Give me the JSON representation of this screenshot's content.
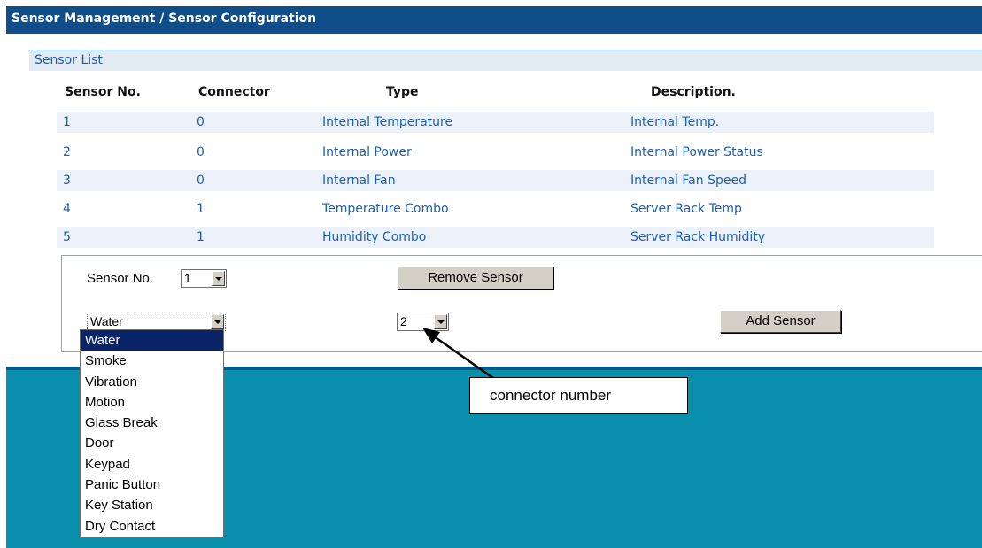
{
  "title": "Sensor Management / Sensor Configuration",
  "section_title": "Sensor List",
  "table": {
    "headers": [
      "Sensor No.",
      "Connector",
      "Type",
      "Description."
    ],
    "rows": [
      [
        "1",
        "0",
        "Internal Temperature",
        "Internal Temp."
      ],
      [
        "2",
        "0",
        "Internal Power",
        "Internal Power Status"
      ],
      [
        "3",
        "0",
        "Internal Fan",
        "Internal Fan Speed"
      ],
      [
        "4",
        "1",
        "Temperature Combo",
        "Server Rack Temp"
      ],
      [
        "5",
        "1",
        "Humidity Combo",
        "Server Rack Humidity"
      ]
    ]
  },
  "form": {
    "sensor_no_label": "Sensor No.",
    "sensor_no_value": "1",
    "remove_button": "Remove Sensor",
    "type_value": "Water",
    "connector_value": "2",
    "add_button": "Add Sensor"
  },
  "dropdown_options": [
    "Water",
    "Smoke",
    "Vibration",
    "Motion",
    "Glass Break",
    "Door",
    "Keypad",
    "Panic Button",
    "Key Station",
    "Dry Contact"
  ],
  "dropdown_selected_index": 0,
  "callout_text": "connector number",
  "colors": {
    "title_bar": "#104e8b",
    "background": "#0a8fad",
    "link_text": "#1f5db0",
    "row_shade": "#ebf2f9",
    "selected_option": "#0a246a"
  }
}
